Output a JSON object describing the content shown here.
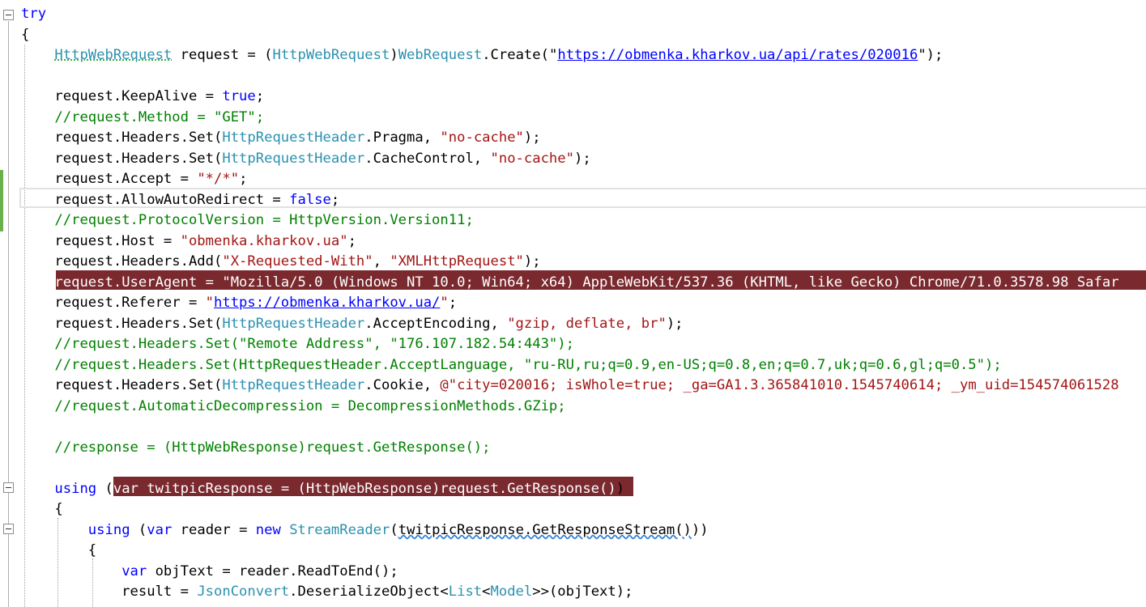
{
  "editor": {
    "lines": [
      [
        {
          "t": "try",
          "c": "kw"
        }
      ],
      [
        {
          "t": "{"
        }
      ],
      [
        {
          "t": "    "
        },
        {
          "t": "HttpWebRequest",
          "c": "ty dot-u"
        },
        {
          "t": " request = ("
        },
        {
          "t": "HttpWebRequest",
          "c": "ty"
        },
        {
          "t": ")"
        },
        {
          "t": "WebRequest",
          "c": "ty"
        },
        {
          "t": ".Create("
        },
        {
          "t": "\""
        },
        {
          "t": "https://obmenka.kharkov.ua/api/rates/020016",
          "c": "lk"
        },
        {
          "t": "\");"
        }
      ],
      [
        {
          "t": ""
        }
      ],
      [
        {
          "t": "    request.KeepAlive = "
        },
        {
          "t": "true",
          "c": "kw"
        },
        {
          "t": ";"
        }
      ],
      [
        {
          "t": "    "
        },
        {
          "t": "//request.Method = \"GET\";",
          "c": "cm"
        }
      ],
      [
        {
          "t": "    request.Headers.Set("
        },
        {
          "t": "HttpRequestHeader",
          "c": "ty"
        },
        {
          "t": ".Pragma, "
        },
        {
          "t": "\"no-cache\"",
          "c": "st"
        },
        {
          "t": ");"
        }
      ],
      [
        {
          "t": "    request.Headers.Set("
        },
        {
          "t": "HttpRequestHeader",
          "c": "ty"
        },
        {
          "t": ".CacheControl, "
        },
        {
          "t": "\"no-cache\"",
          "c": "st"
        },
        {
          "t": ");"
        }
      ],
      [
        {
          "t": "    request.Accept = "
        },
        {
          "t": "\"*/*\"",
          "c": "st"
        },
        {
          "t": ";"
        }
      ],
      [
        {
          "t": "    request.AllowAutoRedirect = "
        },
        {
          "t": "false",
          "c": "kw"
        },
        {
          "t": ";"
        }
      ],
      [
        {
          "t": "    "
        },
        {
          "t": "//request.ProtocolVersion = HttpVersion.Version11;",
          "c": "cm"
        }
      ],
      [
        {
          "t": "    request.Host = "
        },
        {
          "t": "\"obmenka.kharkov.ua\"",
          "c": "st"
        },
        {
          "t": ";"
        }
      ],
      [
        {
          "t": "    request.Headers.Add("
        },
        {
          "t": "\"X-Requested-With\"",
          "c": "st"
        },
        {
          "t": ", "
        },
        {
          "t": "\"XMLHttpRequest\"",
          "c": "st"
        },
        {
          "t": ");"
        }
      ],
      [
        {
          "t": "    "
        },
        {
          "t": "request.UserAgent = \"Mozilla/5.0 (Windows NT 10.0; Win64; x64) AppleWebKit/537.36 (KHTML, like Gecko) Chrome/71.0.3578.98 Safar",
          "c": "hl-text"
        }
      ],
      [
        {
          "t": "    request.Referer = "
        },
        {
          "t": "\"",
          "c": "st"
        },
        {
          "t": "https://obmenka.kharkov.ua/",
          "c": "lk"
        },
        {
          "t": "\"",
          "c": "st"
        },
        {
          "t": ";"
        }
      ],
      [
        {
          "t": "    request.Headers.Set("
        },
        {
          "t": "HttpRequestHeader",
          "c": "ty"
        },
        {
          "t": ".AcceptEncoding, "
        },
        {
          "t": "\"gzip, deflate, br\"",
          "c": "st"
        },
        {
          "t": ");"
        }
      ],
      [
        {
          "t": "    "
        },
        {
          "t": "//request.Headers.Set(\"Remote Address\", \"176.107.182.54:443\");",
          "c": "cm"
        }
      ],
      [
        {
          "t": "    "
        },
        {
          "t": "//request.Headers.Set(HttpRequestHeader.AcceptLanguage, \"ru-RU,ru;q=0.9,en-US;q=0.8,en;q=0.7,uk;q=0.6,gl;q=0.5\");",
          "c": "cm"
        }
      ],
      [
        {
          "t": "    request.Headers.Set("
        },
        {
          "t": "HttpRequestHeader",
          "c": "ty"
        },
        {
          "t": ".Cookie, "
        },
        {
          "t": "@\"city=020016; isWhole=true; _ga=GA1.3.365841010.1545740614; _ym_uid=154574061528",
          "c": "st"
        }
      ],
      [
        {
          "t": "    "
        },
        {
          "t": "//request.AutomaticDecompression = DecompressionMethods.GZip;",
          "c": "cm"
        }
      ],
      [
        {
          "t": ""
        }
      ],
      [
        {
          "t": "    "
        },
        {
          "t": "//response = (HttpWebResponse)request.GetResponse();",
          "c": "cm"
        }
      ],
      [
        {
          "t": ""
        }
      ],
      [
        {
          "t": "    "
        },
        {
          "t": "using",
          "c": "kw"
        },
        {
          "t": " ("
        },
        {
          "t": "var twitpicResponse = (HttpWebResponse)request.GetResponse()",
          "c": "hl-text"
        },
        {
          "t": ")"
        }
      ],
      [
        {
          "t": "    {"
        }
      ],
      [
        {
          "t": "        "
        },
        {
          "t": "using",
          "c": "kw"
        },
        {
          "t": " ("
        },
        {
          "t": "var",
          "c": "kw"
        },
        {
          "t": " reader = "
        },
        {
          "t": "new",
          "c": "kw"
        },
        {
          "t": " "
        },
        {
          "t": "StreamReader",
          "c": "ty"
        },
        {
          "t": "("
        },
        {
          "t": "twitpicResponse.GetResponseStream()",
          "c": "sq"
        },
        {
          "t": "))"
        }
      ],
      [
        {
          "t": "        {"
        }
      ],
      [
        {
          "t": "            "
        },
        {
          "t": "var",
          "c": "kw"
        },
        {
          "t": " objText = reader.ReadToEnd();"
        }
      ],
      [
        {
          "t": "            result = "
        },
        {
          "t": "JsonConvert",
          "c": "ty"
        },
        {
          "t": ".DeserializeObject<"
        },
        {
          "t": "List",
          "c": "ty"
        },
        {
          "t": "<"
        },
        {
          "t": "Model",
          "c": "ty"
        },
        {
          "t": ">>(objText);"
        }
      ],
      [
        {
          "t": ""
        }
      ]
    ]
  },
  "colors": {
    "keyword": "#0000ff",
    "type": "#2b91af",
    "string": "#a31515",
    "comment": "#008000",
    "breakpoint_highlight": "#7a2a2f",
    "change_bar": "#6ab04c"
  }
}
